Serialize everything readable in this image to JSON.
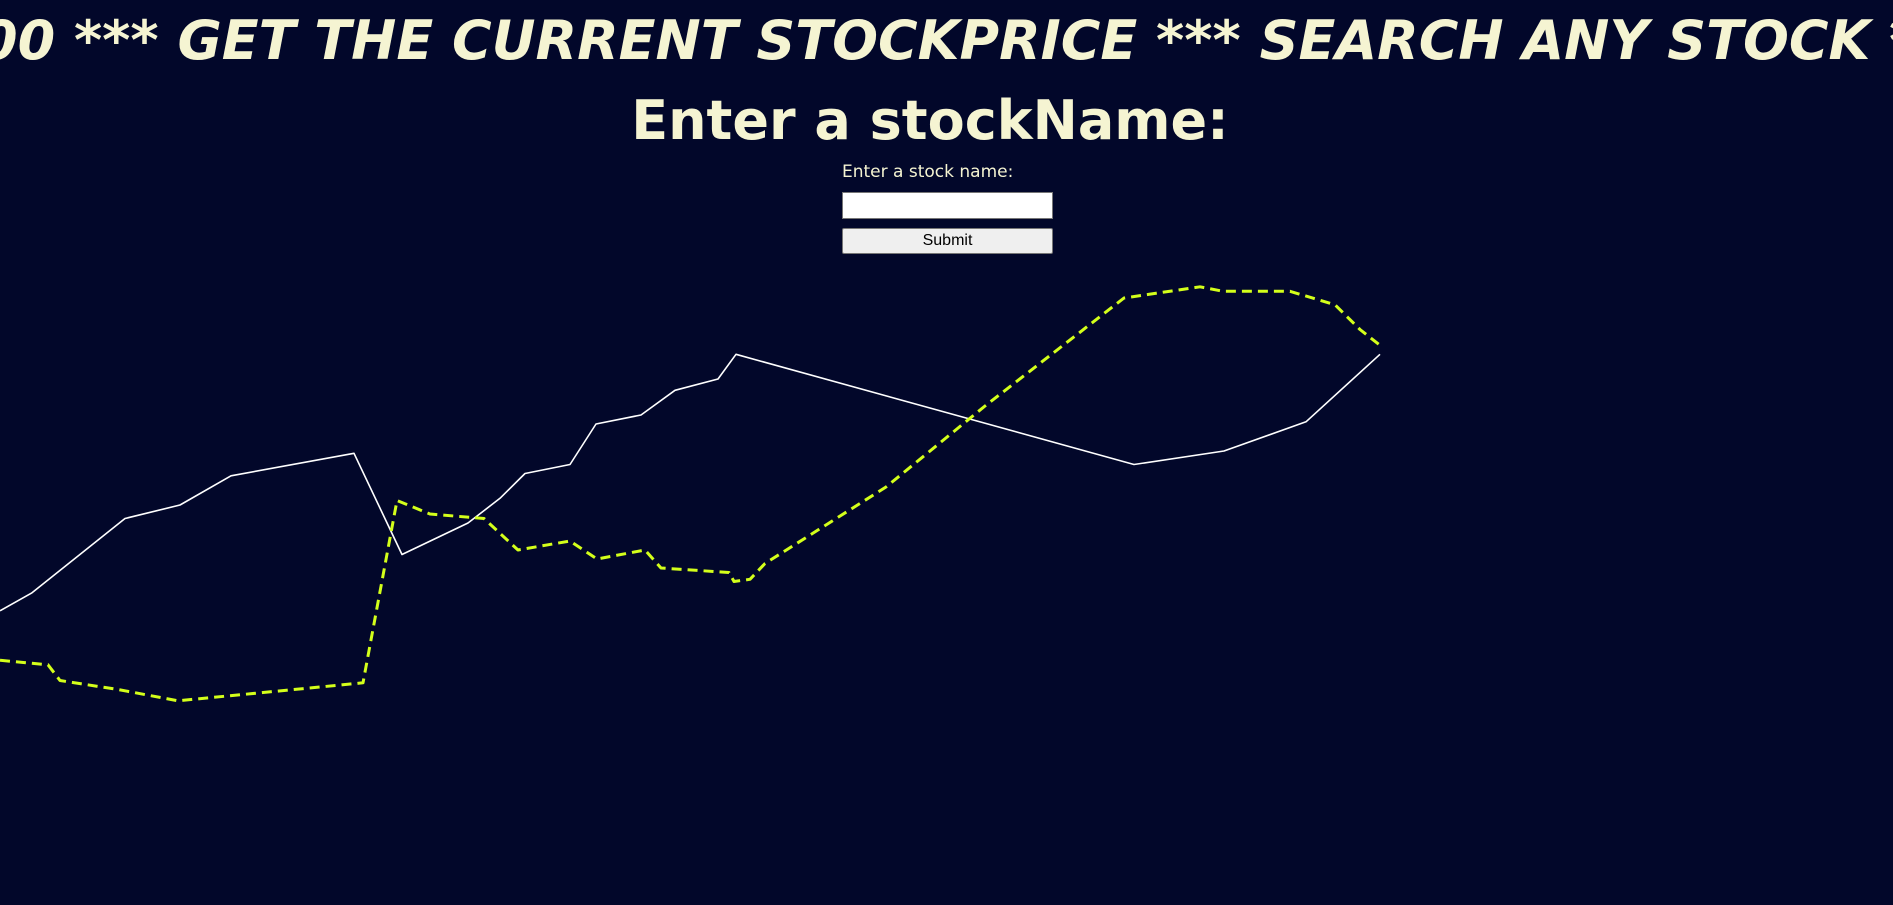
{
  "marquee": {
    "text": "00   ***   GET THE CURRENT STOCKPRICE   ***   SEARCH ANY STOCK   *"
  },
  "heading": "Enter a stockName:",
  "form": {
    "label": "Enter a stock name:",
    "input_value": "",
    "input_placeholder": "",
    "submit_label": "Submit"
  },
  "colors": {
    "background": "#02072a",
    "text": "#f5f4d2",
    "solid_line": "#ffffff",
    "dashed_line": "#d4ff1a"
  },
  "chart_data": {
    "type": "line",
    "title": "",
    "xlabel": "",
    "ylabel": "",
    "grid": false,
    "ylim": [
      0,
      100
    ],
    "xlim": [
      0,
      1380
    ],
    "series": [
      {
        "style": "solid",
        "color": "#ffffff",
        "points": [
          [
            0,
            46.5
          ],
          [
            32,
            50.5
          ],
          [
            125,
            67
          ],
          [
            180,
            70
          ],
          [
            231,
            76.5
          ],
          [
            354,
            81.5
          ],
          [
            402,
            59
          ],
          [
            468,
            66
          ],
          [
            500,
            71.5
          ],
          [
            525,
            77
          ],
          [
            570,
            79
          ],
          [
            596,
            88
          ],
          [
            641,
            90
          ],
          [
            675,
            95.5
          ],
          [
            718,
            98
          ],
          [
            736,
            103.5
          ],
          [
            1134,
            79
          ],
          [
            1224,
            82
          ],
          [
            1306,
            88.5
          ],
          [
            1380,
            103.5
          ]
        ]
      },
      {
        "style": "dashed",
        "color": "#d4ff1a",
        "points": [
          [
            0,
            35.5
          ],
          [
            48,
            34.5
          ],
          [
            60,
            31
          ],
          [
            118,
            29
          ],
          [
            178,
            26.5
          ],
          [
            363,
            30.5
          ],
          [
            397,
            71
          ],
          [
            430,
            68
          ],
          [
            484,
            67
          ],
          [
            518,
            60
          ],
          [
            570,
            62
          ],
          [
            597,
            58
          ],
          [
            645,
            60
          ],
          [
            661,
            56
          ],
          [
            729,
            55
          ],
          [
            734,
            53
          ],
          [
            750,
            53.5
          ],
          [
            765,
            57
          ],
          [
            886,
            74
          ],
          [
            985,
            92
          ],
          [
            1124,
            116
          ],
          [
            1200,
            118.5
          ],
          [
            1223,
            117.5
          ],
          [
            1290,
            117.5
          ],
          [
            1335,
            114.5
          ],
          [
            1360,
            109
          ],
          [
            1380,
            105.5
          ]
        ]
      }
    ]
  }
}
